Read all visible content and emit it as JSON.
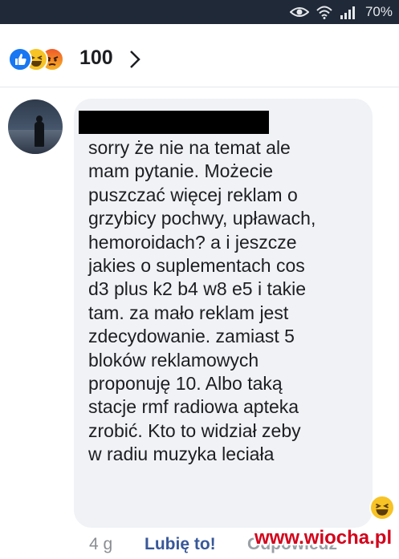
{
  "status_bar": {
    "battery": "70%",
    "icons": [
      "eye-icon",
      "wifi-icon",
      "signal-icon"
    ]
  },
  "reactions": {
    "count": "100",
    "icons": [
      "like-icon",
      "haha-icon",
      "angry-icon"
    ]
  },
  "comment": {
    "author_redacted": true,
    "lines": [
      "sorry że nie na temat ale",
      "mam pytanie. Możecie",
      "puszczać więcej reklam o",
      "grzybicy pochwy, upławach,",
      "hemoroidach? a i jeszcze",
      "jakies o suplementach cos",
      "d3 plus k2 b4 w8 e5 i takie",
      "tam. za mało reklam jest",
      "zdecydowanie. zamiast 5",
      "bloków reklamowych",
      "proponuję 10. Albo taką",
      "stacje rmf radiowa apteka",
      "zrobić. Kto to widział zeby",
      "w radiu muzyka leciała"
    ],
    "reaction_icon": "haha-icon"
  },
  "actions": {
    "time": "4 g",
    "like": "Lubię to!",
    "reply": "Odpowiedz"
  },
  "watermark": "www.wiocha.pl",
  "colors": {
    "like_blue": "#1877f2",
    "link_blue": "#385898",
    "bubble": "#f0f2f5",
    "status_bar": "#1f2937",
    "watermark_red": "#d4001a"
  }
}
